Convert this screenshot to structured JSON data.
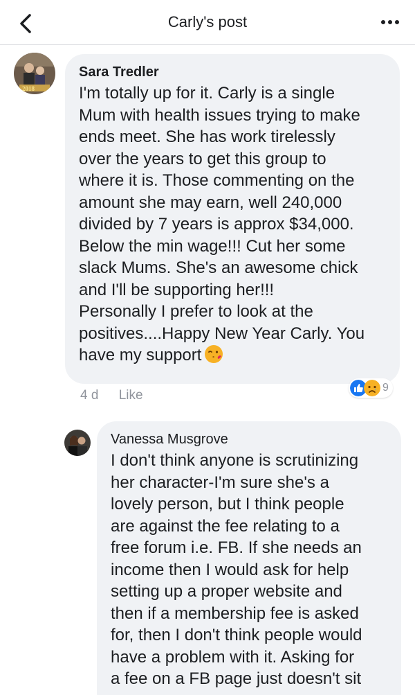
{
  "header": {
    "title": "Carly's post",
    "back_icon": "chevron-left-icon",
    "more_icon": "more-horizontal-icon"
  },
  "comments": [
    {
      "author": "Sara Tredler",
      "avatar_icon": "profile-photo",
      "text": "I'm totally up for it. Carly is a single\nMum with health issues trying to make\nends meet. She has work tirelessly\nover the years to get this group to\nwhere it is. Those commenting on the\namount she may earn, well 240,000\ndivided by 7 years is approx $34,000.\nBelow the min wage!!! Cut her some\nslack Mums. She's an awesome chick\nand I'll be supporting her!!!\nPersonally I prefer to look at the\npositives....Happy New Year Carly. You\nhave my support",
      "emoji": "kissing-face-emoji",
      "time": "4 d",
      "like_label": "Like",
      "reaction_count": "9",
      "reaction_icons": [
        "like-reaction-icon",
        "sad-reaction-icon"
      ]
    },
    {
      "author": "Vanessa Musgrove",
      "avatar_icon": "profile-photo",
      "text": "I don't think anyone is scrutinizing\nher character-I'm sure she's a\nlovely person, but I think people\nare against the fee relating to a\nfree forum i.e. FB. If she needs an\nincome then I would ask for help\nsetting up a proper website and\nthen if a membership fee is asked\nfor, then I don't think people would\nhave a problem with it. Asking for\na fee on a FB page just doesn't sit"
    }
  ],
  "colors": {
    "bubble": "#f0f2f5",
    "like_blue": "#1877f2",
    "sad_yellow": "#f7b125",
    "meta_gray": "#90949c"
  }
}
